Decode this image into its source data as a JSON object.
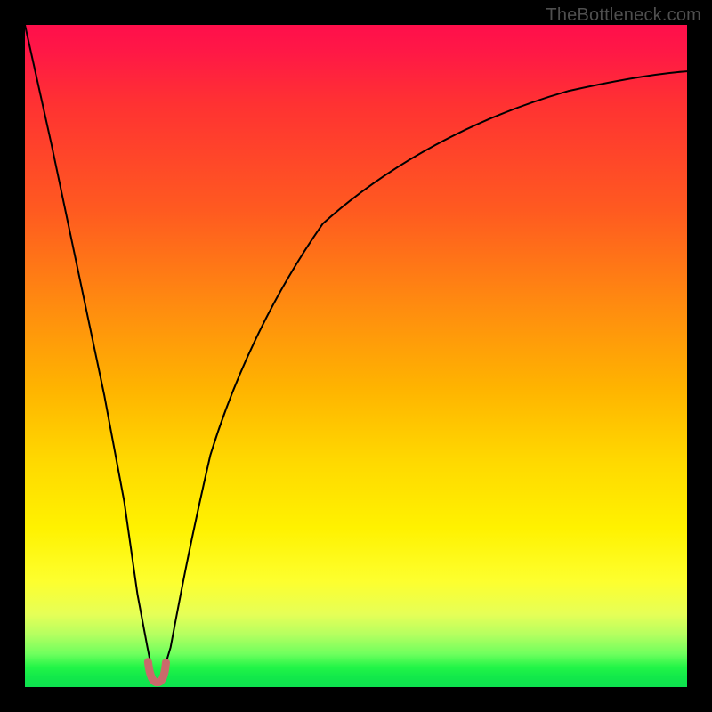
{
  "watermark": {
    "text": "TheBottleneck.com"
  },
  "chart_data": {
    "type": "line",
    "title": "",
    "xlabel": "",
    "ylabel": "",
    "xlim": [
      0,
      100
    ],
    "ylim": [
      0,
      100
    ],
    "grid": false,
    "series": [
      {
        "name": "bottleneck-curve",
        "x": [
          0,
          4,
          8,
          12,
          15,
          17,
          18.5,
          19.5,
          20.5,
          22,
          23.5,
          25,
          28,
          32,
          38,
          45,
          55,
          68,
          82,
          100
        ],
        "values": [
          100,
          82,
          63,
          44,
          28,
          14,
          6,
          1,
          1,
          6,
          14,
          22,
          35,
          48,
          60,
          70,
          79,
          86,
          90,
          93
        ]
      }
    ],
    "marker": {
      "name": "min-region",
      "color": "#c96a6b",
      "x_range": [
        18.5,
        21.0
      ],
      "y_range": [
        0,
        4
      ]
    },
    "gradient_stops": [
      {
        "pct": 0,
        "color": "#ff0f4b"
      },
      {
        "pct": 28,
        "color": "#ff5a20"
      },
      {
        "pct": 55,
        "color": "#ffb400"
      },
      {
        "pct": 76,
        "color": "#fff200"
      },
      {
        "pct": 95,
        "color": "#6fff5e"
      },
      {
        "pct": 100,
        "color": "#0de24f"
      }
    ]
  }
}
